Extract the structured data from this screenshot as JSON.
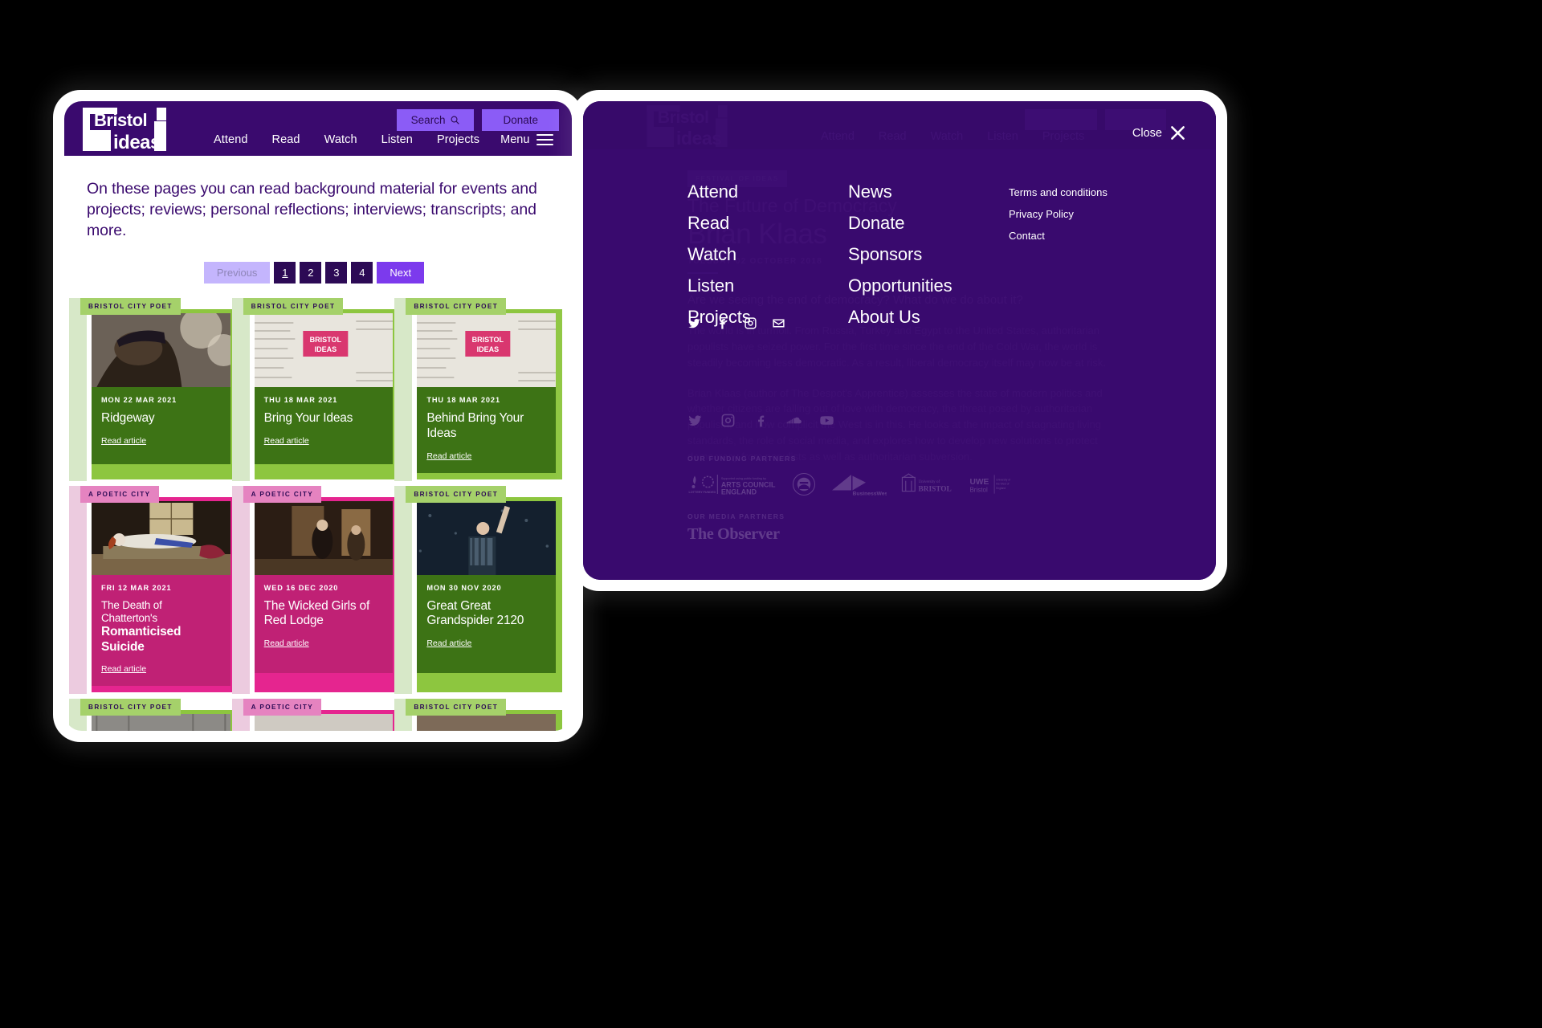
{
  "site": {
    "logo_line1": "Bristol",
    "logo_line2": "ideas",
    "brand_purple": "#3a0a6e",
    "accent_violet": "#8b5cf6",
    "green_dark": "#3d7315",
    "green_tag": "#a5d16a",
    "pink_dark": "#c02175",
    "pink_tag": "#e583c0"
  },
  "header": {
    "nav": [
      {
        "label": "Attend"
      },
      {
        "label": "Read"
      },
      {
        "label": "Watch"
      },
      {
        "label": "Listen"
      },
      {
        "label": "Projects"
      }
    ],
    "menu_label": "Menu",
    "search_label": "Search",
    "search_icon": "magnifier-icon",
    "donate_label": "Donate"
  },
  "page": {
    "intro": "On these pages you can read background material for events and projects; reviews; personal reflections; interviews; transcripts; and more."
  },
  "pagination": {
    "previous_label": "Previous",
    "next_label": "Next",
    "pages": [
      "1",
      "2",
      "3",
      "4"
    ],
    "current_page": "1"
  },
  "cards": [
    {
      "tag": "BRISTOL CITY POET",
      "theme": "green",
      "date": "MON 22 MAR 2021",
      "title": "Ridgeway",
      "subtitle": "",
      "read_label": "Read article",
      "image": "portrait-man-cap-looking-up"
    },
    {
      "tag": "BRISTOL CITY POET",
      "theme": "green",
      "date": "THU 18 MAR 2021",
      "title": "Bring Your Ideas",
      "subtitle": "",
      "read_label": "Read article",
      "image": "handwritten-notes-bristol-ideas-banner"
    },
    {
      "tag": "BRISTOL CITY POET",
      "theme": "green",
      "date": "THU 18 MAR 2021",
      "title": "Behind Bring Your Ideas",
      "subtitle": "",
      "read_label": "Read article",
      "image": "handwritten-notes-bristol-ideas-banner"
    },
    {
      "tag": "A POETIC CITY",
      "theme": "pink",
      "date": "FRI 12 MAR 2021",
      "title": "Romanticised Suicide",
      "subtitle": "The Death of Chatterton's",
      "read_label": "Read article",
      "image": "death-of-chatterton-painting"
    },
    {
      "tag": "A POETIC CITY",
      "theme": "pink",
      "date": "WED 16 DEC 2020",
      "title": "The Wicked Girls of Red Lodge",
      "subtitle": "",
      "read_label": "Read article",
      "image": "victorian-interior-painting"
    },
    {
      "tag": "BRISTOL CITY POET",
      "theme": "green",
      "date": "MON 30 NOV 2020",
      "title": "Great Great Grandspider 2120",
      "subtitle": "",
      "read_label": "Read article",
      "image": "man-arm-raised-night"
    },
    {
      "tag": "BRISTOL CITY POET",
      "theme": "green",
      "date": "",
      "title": "",
      "subtitle": "",
      "read_label": "",
      "image": "person-glasses-wooden-wall"
    },
    {
      "tag": "A POETIC CITY",
      "theme": "pink",
      "date": "",
      "title": "",
      "subtitle": "",
      "read_label": "",
      "image": "smiling-woman-headscarf"
    },
    {
      "tag": "BRISTOL CITY POET",
      "theme": "green",
      "date": "",
      "title": "",
      "subtitle": "",
      "read_label": "",
      "image": "man-portrait-brick"
    }
  ],
  "menu_overlay": {
    "close_label": "Close",
    "close_icon": "close-x-icon",
    "primary": [
      {
        "label": "Attend"
      },
      {
        "label": "Read"
      },
      {
        "label": "Watch"
      },
      {
        "label": "Listen"
      },
      {
        "label": "Projects"
      }
    ],
    "secondary": [
      {
        "label": "News"
      },
      {
        "label": "Donate"
      },
      {
        "label": "Sponsors"
      },
      {
        "label": "Opportunities"
      },
      {
        "label": "About Us"
      }
    ],
    "tertiary": [
      {
        "label": "Terms and conditions"
      },
      {
        "label": "Privacy Policy"
      },
      {
        "label": "Contact"
      }
    ],
    "social": [
      "twitter-icon",
      "facebook-icon",
      "instagram-icon",
      "email-icon"
    ]
  },
  "background_article": {
    "tag": "FESTIVAL OF IDEAS",
    "kicker": "The Future of Democracy",
    "speaker": "Brian Klaas",
    "date": "TUESDAY 02 OCTOBER 2018",
    "lede": "Are we seeing the end of democracy? What do we do about it?",
    "paragraph1": "The world is in turmoil. From Russia, Turkey and Egypt to the United States, authoritarian populists have seized power. For the first time since the end of the Cold War, the world is steadily becoming less democratic. As a result, liberal democracy itself may now be at risk.",
    "paragraph2": "Brian Klaas (author of The Despot's Apprentice) assesses the state of modern politics and whether citizens are falling out of love with democracy, the threat posed by authoritarian populism, and how complicit the West is in this. He looks at the impact of stagnating living standards, the role of social media, and explores how to develop new solutions to protect democracy from populists as well as authoritarian subversion.",
    "social": [
      "twitter-icon",
      "instagram-icon",
      "facebook-icon",
      "soundcloud-icon",
      "youtube-icon"
    ],
    "funding_label": "OUR FUNDING PARTNERS",
    "media_label": "OUR MEDIA PARTNERS",
    "funding_partners": [
      "Arts Council England (Lottery Funded)",
      "Bristol City Council",
      "BusinessWest",
      "University of Bristol",
      "UWE Bristol"
    ],
    "media_partner": "The Observer",
    "logos": {
      "arts_council_line1": "ARTS COUNCIL",
      "arts_council_line2": "ENGLAND",
      "arts_council_small": "Supported using public funding by",
      "lottery": "LOTTERY FUNDED",
      "bcc_text": "BRISTOL CITY COUNCIL",
      "businesswest": "BusinessWest",
      "uob_line1": "University of",
      "uob_line2": "BRISTOL",
      "uwe_line1": "UWE",
      "uwe_line2": "Bristol",
      "uwe_small": "University of the West of England"
    }
  }
}
